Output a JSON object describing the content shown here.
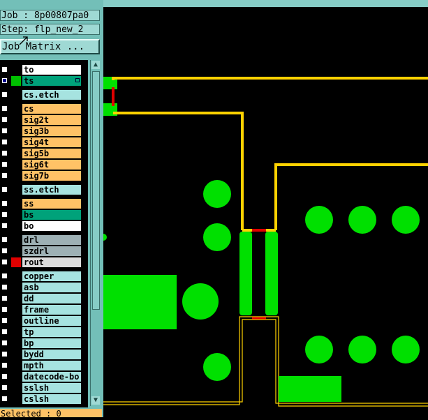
{
  "header": {
    "job": "Job : 8p00807pa0",
    "step": "Step: flp_new_2",
    "job_matrix_button": "Job Matrix ..."
  },
  "layers": [
    {
      "name": "to",
      "color": "white",
      "swatch": "#000000",
      "checked": false
    },
    {
      "name": "ts",
      "color": "green",
      "swatch": "#00c000",
      "checked": true,
      "marker": true
    },
    {
      "name": "cs.etch",
      "color": "cyan",
      "swatch": "#000000",
      "checked": false
    },
    {
      "name": "cs",
      "color": "orange",
      "swatch": "#000000",
      "checked": false
    },
    {
      "name": "sig2t",
      "color": "orange",
      "swatch": "#000000",
      "checked": false
    },
    {
      "name": "sig3b",
      "color": "orange",
      "swatch": "#000000",
      "checked": false
    },
    {
      "name": "sig4t",
      "color": "orange",
      "swatch": "#000000",
      "checked": false
    },
    {
      "name": "sig5b",
      "color": "orange",
      "swatch": "#000000",
      "checked": false
    },
    {
      "name": "sig6t",
      "color": "orange",
      "swatch": "#000000",
      "checked": false
    },
    {
      "name": "sig7b",
      "color": "orange",
      "swatch": "#000000",
      "checked": false
    },
    {
      "name": "ss.etch",
      "color": "cyan",
      "swatch": "#000000",
      "checked": false
    },
    {
      "name": "ss",
      "color": "orange",
      "swatch": "#000000",
      "checked": false
    },
    {
      "name": "bs",
      "color": "green",
      "swatch": "#000000",
      "checked": false
    },
    {
      "name": "bo",
      "color": "white",
      "swatch": "#000000",
      "checked": false
    },
    {
      "name": "drl",
      "color": "gray",
      "swatch": "#000000",
      "checked": false
    },
    {
      "name": "szdrl",
      "color": "gray",
      "swatch": "#000000",
      "checked": false
    },
    {
      "name": "rout",
      "color": "ltgray",
      "swatch": "#e00000",
      "checked": false
    },
    {
      "name": "copper",
      "color": "cyan",
      "swatch": "#000000",
      "checked": false
    },
    {
      "name": "asb",
      "color": "cyan",
      "swatch": "#000000",
      "checked": false
    },
    {
      "name": "dd",
      "color": "cyan",
      "swatch": "#000000",
      "checked": false
    },
    {
      "name": "frame",
      "color": "cyan",
      "swatch": "#000000",
      "checked": false
    },
    {
      "name": "outline",
      "color": "cyan",
      "swatch": "#000000",
      "checked": false
    },
    {
      "name": "tp",
      "color": "cyan",
      "swatch": "#000000",
      "checked": false
    },
    {
      "name": "bp",
      "color": "cyan",
      "swatch": "#000000",
      "checked": false
    },
    {
      "name": "bydd",
      "color": "cyan",
      "swatch": "#000000",
      "checked": false
    },
    {
      "name": "mpth",
      "color": "cyan",
      "swatch": "#000000",
      "checked": false
    },
    {
      "name": "datecode-bo",
      "color": "cyan",
      "swatch": "#000000",
      "checked": false
    },
    {
      "name": "sslsh",
      "color": "cyan",
      "swatch": "#000000",
      "checked": false
    },
    {
      "name": "cslsh",
      "color": "cyan",
      "swatch": "#000000",
      "checked": false
    }
  ],
  "status": {
    "selected": "Selected : 0"
  },
  "colors": {
    "panel_bg": "#73bfb8",
    "trace_yellow": "#ffd200",
    "pad_green": "#00e000",
    "trace_red": "#e00000"
  }
}
